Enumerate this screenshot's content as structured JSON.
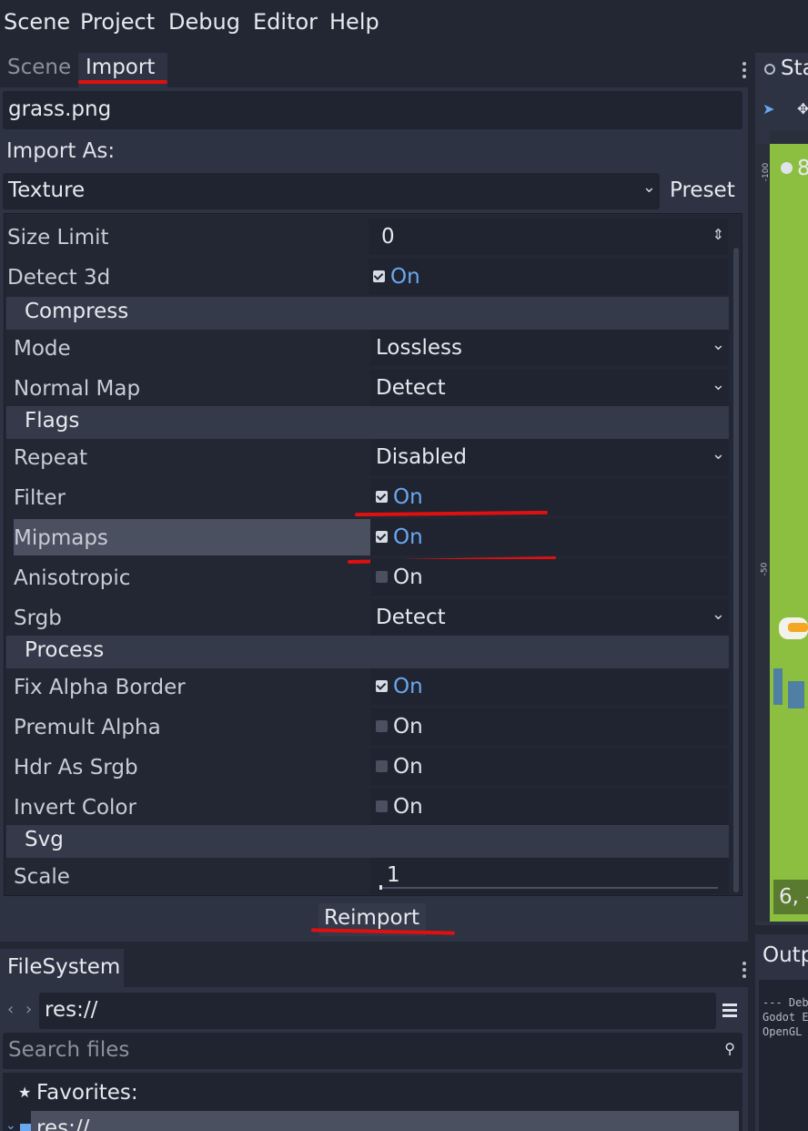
{
  "menu": {
    "scene": "Scene",
    "project": "Project",
    "debug": "Debug",
    "editor": "Editor",
    "help": "Help"
  },
  "dock_tabs": {
    "scene": "Scene",
    "import": "Import"
  },
  "import": {
    "file_name": "grass.png",
    "import_as_label": "Import As:",
    "import_as_value": "Texture",
    "preset_label": "Preset",
    "reimport_label": "Reimport"
  },
  "properties": {
    "size_limit": {
      "label": "Size Limit",
      "value": "0"
    },
    "detect_3d": {
      "label": "Detect 3d",
      "value": "On",
      "checked": true
    },
    "compress_section": "Compress",
    "mode": {
      "label": "Mode",
      "value": "Lossless"
    },
    "normal_map": {
      "label": "Normal Map",
      "value": "Detect"
    },
    "flags_section": "Flags",
    "repeat": {
      "label": "Repeat",
      "value": "Disabled"
    },
    "filter": {
      "label": "Filter",
      "value": "On",
      "checked": true
    },
    "mipmaps": {
      "label": "Mipmaps",
      "value": "On",
      "checked": true
    },
    "anisotropic": {
      "label": "Anisotropic",
      "value": "On",
      "checked": false
    },
    "srgb": {
      "label": "Srgb",
      "value": "Detect"
    },
    "process_section": "Process",
    "fix_alpha_border": {
      "label": "Fix Alpha Border",
      "value": "On",
      "checked": true
    },
    "premult_alpha": {
      "label": "Premult Alpha",
      "value": "On",
      "checked": false
    },
    "hdr_as_srgb": {
      "label": "Hdr As Srgb",
      "value": "On",
      "checked": false
    },
    "invert_color": {
      "label": "Invert Color",
      "value": "On",
      "checked": false
    },
    "svg_section": "Svg",
    "scale": {
      "label": "Scale",
      "value": "1"
    }
  },
  "filesystem": {
    "tab_label": "FileSystem",
    "path": "res://",
    "search_placeholder": "Search files",
    "favorites_label": "Favorites:",
    "tree_item": "res://"
  },
  "right": {
    "tab_label": "Sta",
    "ruler_top": "-100",
    "ruler_mid": "-50",
    "viewport_label": "8",
    "coords": "6, -",
    "output_tab": "Outp",
    "output_lines": [
      "--- Deb",
      "Godot E",
      "OpenGL"
    ]
  },
  "colors": {
    "accent_blue": "#6aa8f0",
    "annotation_red": "#e01010",
    "viewport_green": "#8cbf3f"
  }
}
